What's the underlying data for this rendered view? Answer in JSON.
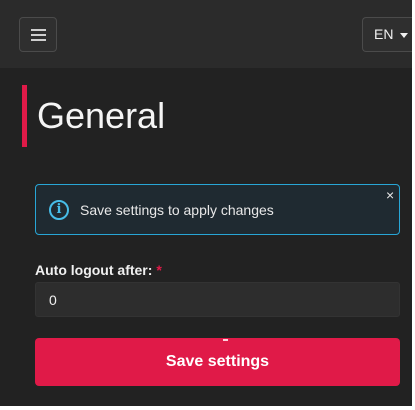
{
  "header": {
    "menu_icon": "hamburger-menu-icon",
    "language": "EN",
    "language_caret_icon": "caret-down-icon"
  },
  "page": {
    "title": "General",
    "accent_color": "#e01a48"
  },
  "alert": {
    "icon": "info-icon",
    "icon_glyph": "i",
    "message": "Save settings to apply changes",
    "close_glyph": "×",
    "color": "#28a6d6"
  },
  "form": {
    "auto_logout": {
      "label": "Auto logout after:",
      "required_mark": "*",
      "value": "0"
    },
    "save_label": "Save settings"
  }
}
